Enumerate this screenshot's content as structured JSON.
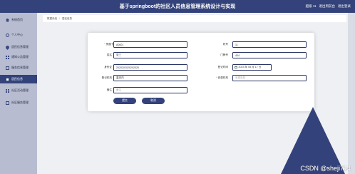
{
  "header": {
    "title": "基于springboot的社区人员信息管理系统设计与实现",
    "user_label": "超级 11",
    "back_home": "退出到前台",
    "logout": "退出登录"
  },
  "sidebar": {
    "items": [
      {
        "label": "系统首页",
        "icon": "house-icon"
      },
      {
        "label": "个人中心",
        "icon": "user-icon"
      },
      {
        "label": "居民信息管理",
        "icon": "pin-icon"
      },
      {
        "label": "通知公告管理",
        "icon": "grid-icon"
      },
      {
        "label": "服务信息管理",
        "icon": "doc-icon"
      },
      {
        "label": "居民信息",
        "icon": "doc-icon",
        "active": true
      },
      {
        "label": "社区活动管理",
        "icon": "grid-icon"
      },
      {
        "label": "社区服务管理",
        "icon": "doc-icon"
      }
    ]
  },
  "breadcrumb": {
    "home": "数据系统",
    "current": "居民信息"
  },
  "form": {
    "house_no": {
      "label": "房屋卡号",
      "value": "A0001"
    },
    "building": {
      "label": "栋号",
      "value": "11"
    },
    "name": {
      "label": "姓名",
      "value": "张三"
    },
    "door": {
      "label": "门牌号",
      "value": "404"
    },
    "id_card": {
      "label": "身份证",
      "value": "2020202020202020"
    },
    "register_time": {
      "label": "登记时间",
      "value": "2023 年 05 月 17 日"
    },
    "register_org": {
      "label": "登记机构",
      "value": "重庆内"
    },
    "receive_org": {
      "label": "收费机构",
      "placeholder": "收费机构"
    },
    "remark": {
      "label": "备注",
      "placeholder": "备注"
    }
  },
  "buttons": {
    "submit": "提交",
    "cancel": "取消"
  },
  "watermark": "CSDN @sheji714",
  "colors": {
    "primary": "#33427a",
    "sidebar": "#b8bcd0",
    "background": "#eef0f4"
  }
}
